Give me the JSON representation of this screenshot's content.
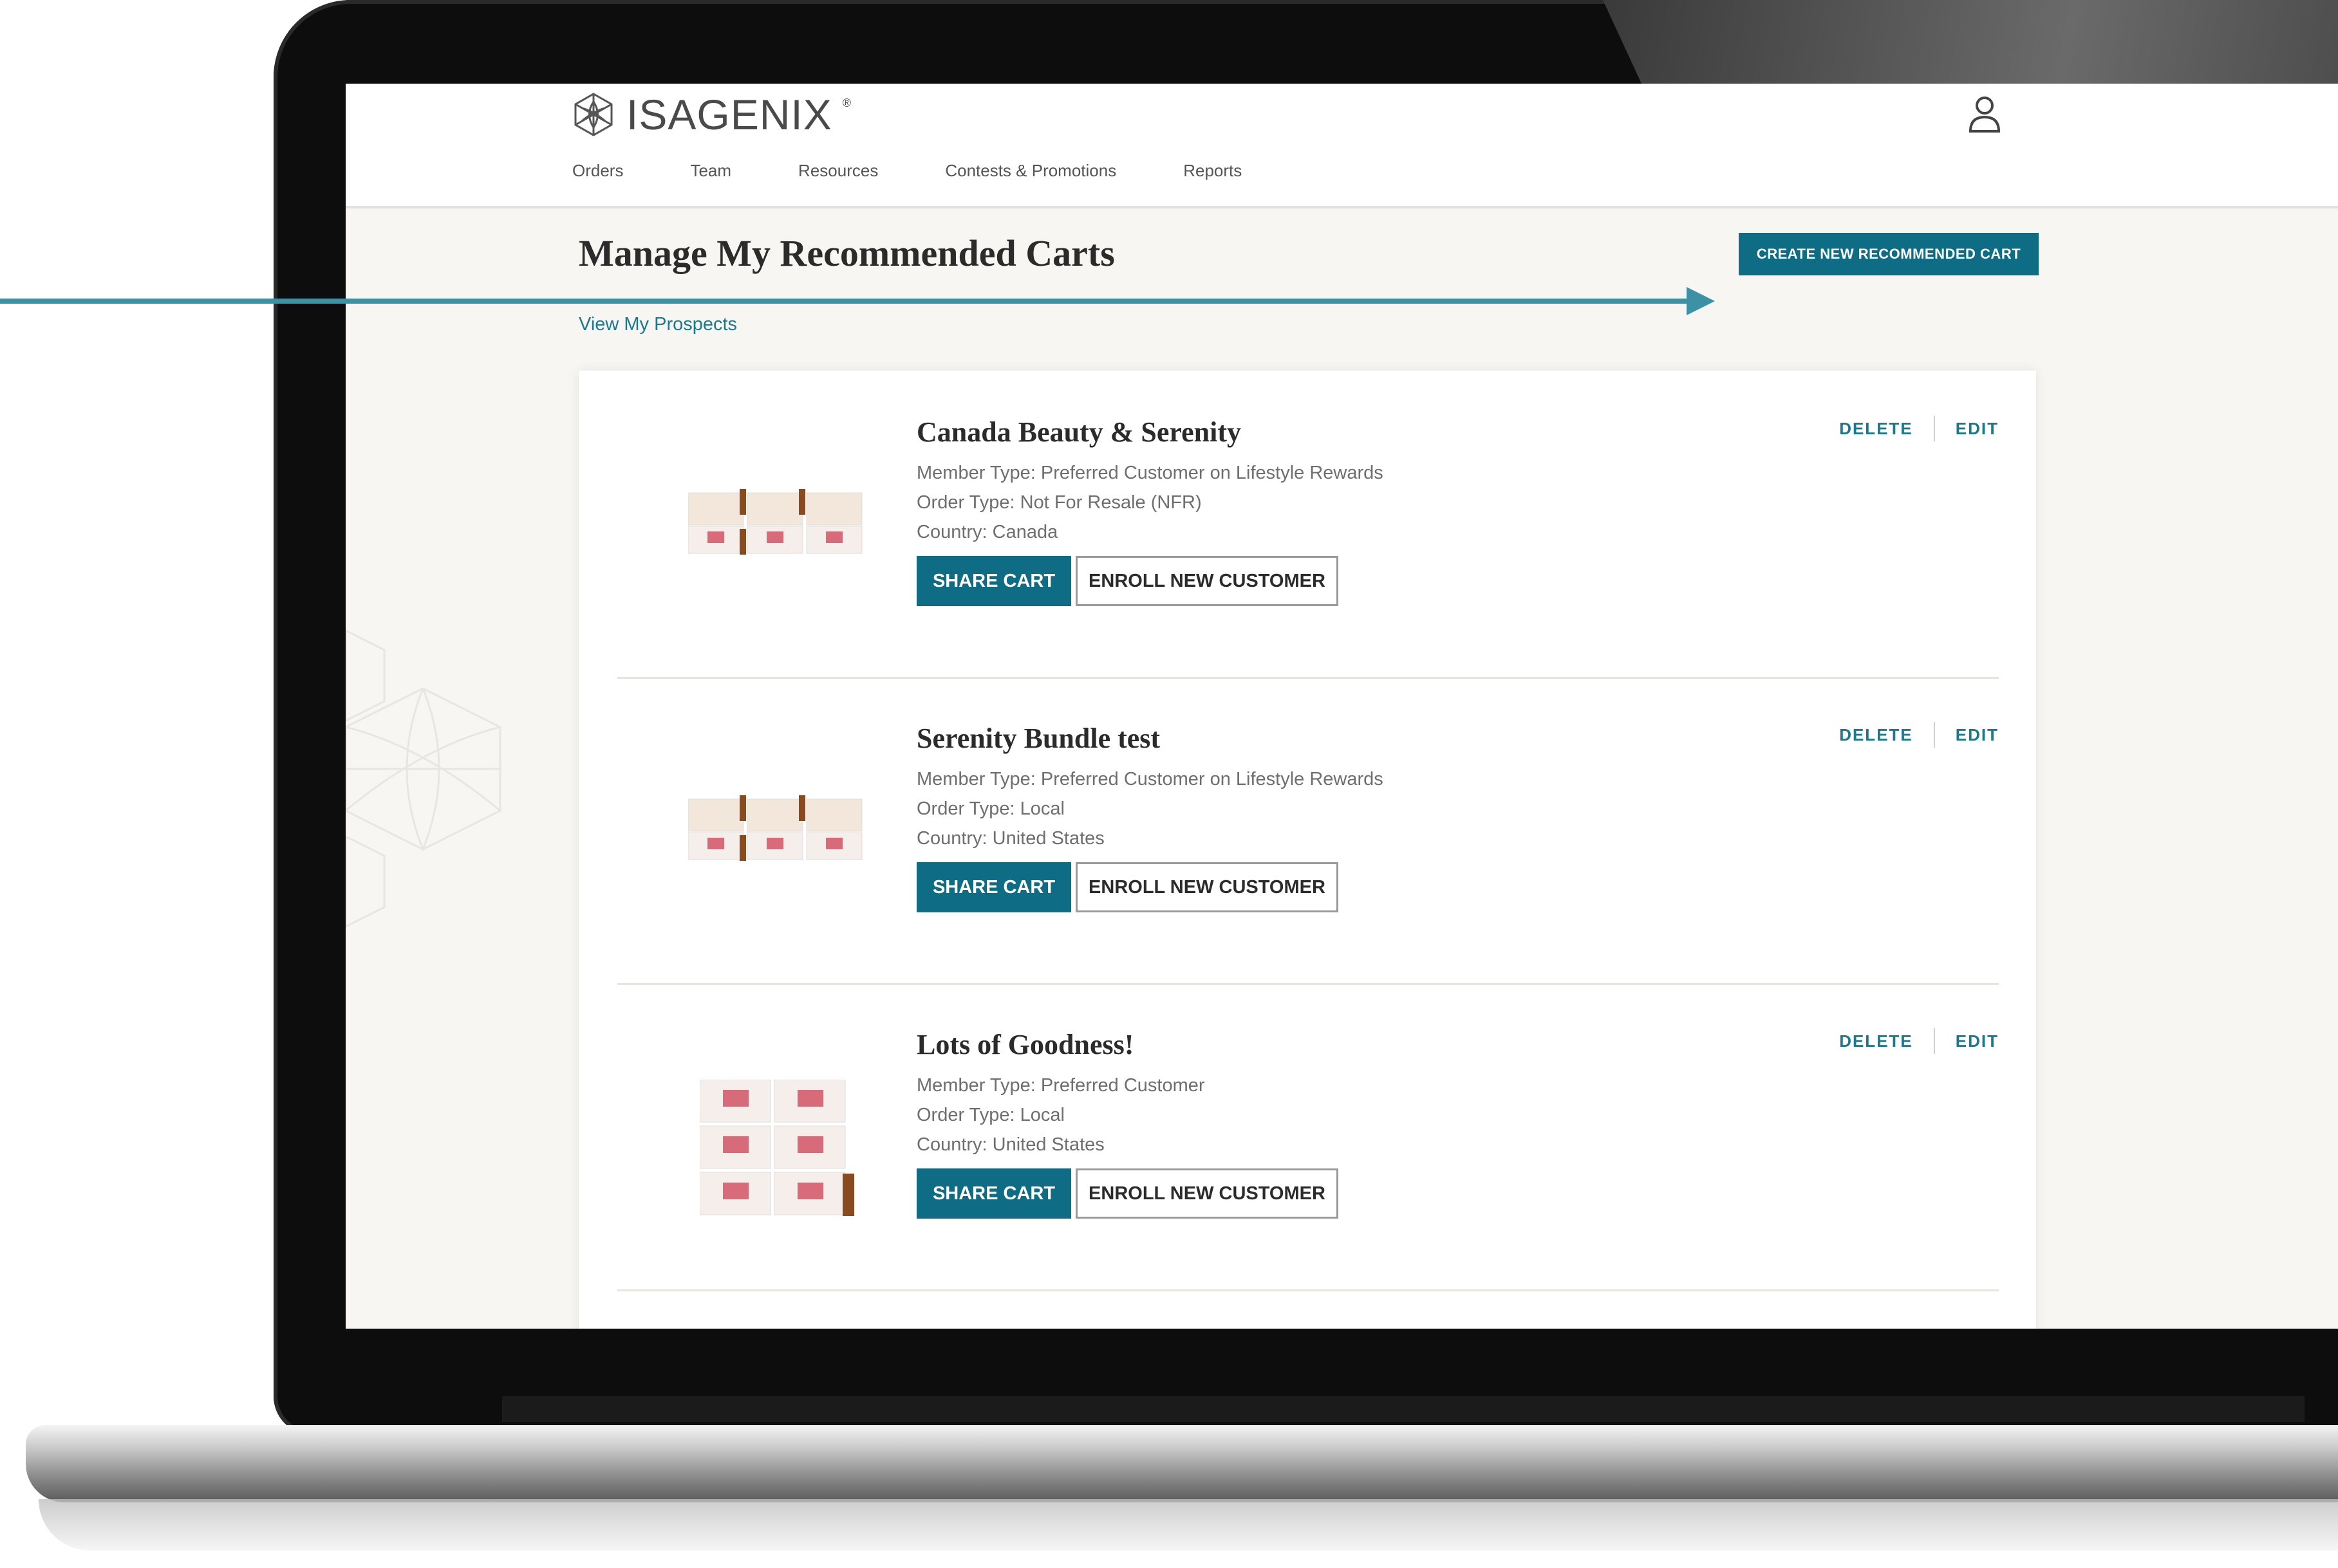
{
  "brand": {
    "name": "ISAGENIX",
    "registered": "®"
  },
  "nav": [
    {
      "label": "Orders"
    },
    {
      "label": "Team"
    },
    {
      "label": "Resources"
    },
    {
      "label": "Contests & Promotions"
    },
    {
      "label": "Reports"
    }
  ],
  "page": {
    "title": "Manage My Recommended Carts",
    "create_button": "CREATE NEW RECOMMENDED CART",
    "prospects_link": "View My Prospects"
  },
  "carts": [
    {
      "title": "Canada Beauty & Serenity",
      "member_type": "Member Type: Preferred Customer on Lifestyle Rewards",
      "order_type": "Order Type: Not For Resale (NFR)",
      "country": "Country: Canada",
      "share": "SHARE CART",
      "enroll": "ENROLL NEW CUSTOMER",
      "delete": "DELETE",
      "edit": "EDIT"
    },
    {
      "title": "Serenity Bundle test",
      "member_type": "Member Type: Preferred Customer on Lifestyle Rewards",
      "order_type": "Order Type: Local",
      "country": "Country: United States",
      "share": "SHARE CART",
      "enroll": "ENROLL NEW CUSTOMER",
      "delete": "DELETE",
      "edit": "EDIT"
    },
    {
      "title": "Lots of Goodness!",
      "member_type": "Member Type: Preferred Customer",
      "order_type": "Order Type: Local",
      "country": "Country: United States",
      "share": "SHARE CART",
      "enroll": "ENROLL NEW CUSTOMER",
      "delete": "DELETE",
      "edit": "EDIT"
    }
  ],
  "icons": {
    "logo": "isagenix-logo-icon",
    "user": "user-icon"
  },
  "colors": {
    "accent": "#0e6d84",
    "link": "#1a7890",
    "arrow": "#3c91a4",
    "background": "#f7f6f2"
  }
}
